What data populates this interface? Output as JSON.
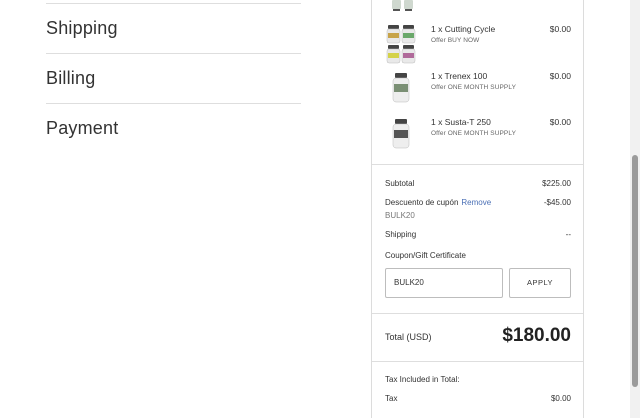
{
  "steps": [
    {
      "label": "Shipping"
    },
    {
      "label": "Billing"
    },
    {
      "label": "Payment"
    }
  ],
  "items": [
    {
      "name": "1 x Cutting Cycle",
      "offer": "Offer BUY NOW",
      "price": "$0.00",
      "icon": "product-bottles-icon"
    },
    {
      "name": "1 x Trenex 100",
      "offer": "Offer ONE MONTH SUPPLY",
      "price": "$0.00",
      "icon": "product-bottle-icon"
    },
    {
      "name": "1 x Susta-T 250",
      "offer": "Offer ONE MONTH SUPPLY",
      "price": "$0.00",
      "icon": "product-bottle-icon"
    }
  ],
  "totals": {
    "subtotal_label": "Subtotal",
    "subtotal_value": "$225.00",
    "discount_label": "Descuento de cupón",
    "discount_remove": "Remove",
    "discount_value": "-$45.00",
    "discount_code": "BULK20",
    "shipping_label": "Shipping",
    "shipping_value": "--"
  },
  "coupon": {
    "label": "Coupon/Gift Certificate",
    "value": "BULK20",
    "apply_label": "APPLY"
  },
  "grand_total": {
    "label": "Total (USD)",
    "value": "$180.00"
  },
  "tax": {
    "included_label": "Tax Included in Total:",
    "tax_label": "Tax",
    "tax_value": "$0.00"
  }
}
